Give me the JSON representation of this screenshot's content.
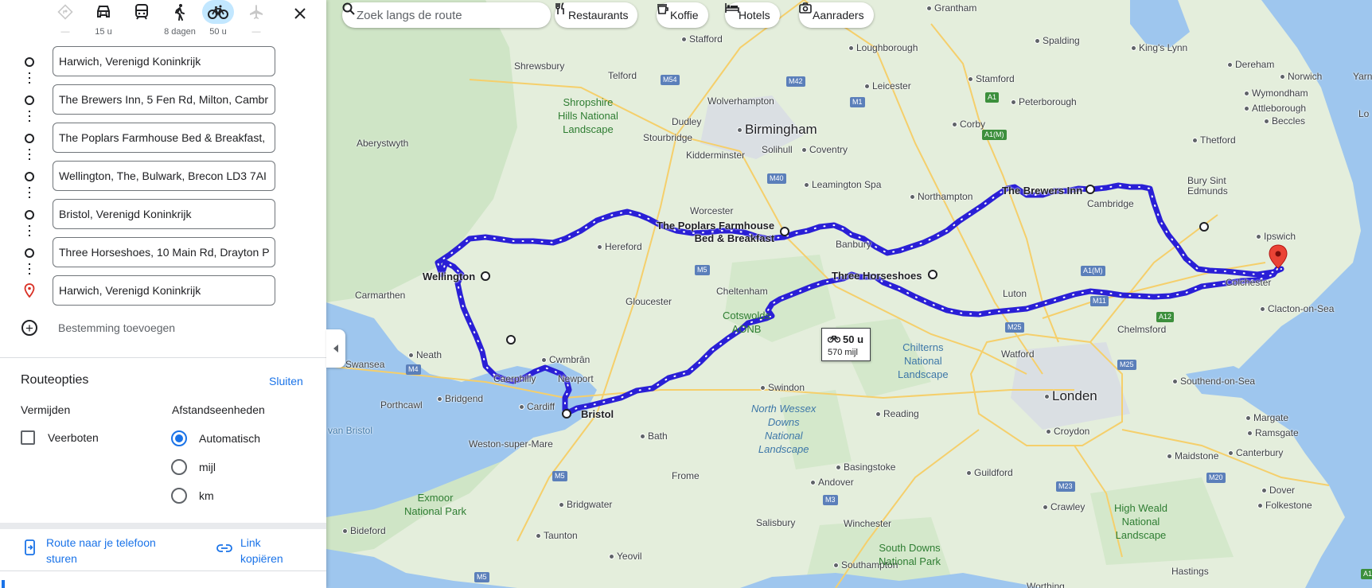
{
  "modes": [
    {
      "name": "best-route",
      "label": "—",
      "icon": "diamond-route-icon",
      "active": false,
      "disabled": true
    },
    {
      "name": "car",
      "label": "15 u",
      "icon": "car-icon",
      "active": false,
      "disabled": false
    },
    {
      "name": "transit",
      "label": "",
      "icon": "train-icon",
      "active": false,
      "disabled": false
    },
    {
      "name": "walk",
      "label": "8 dagen",
      "icon": "walk-icon",
      "active": false,
      "disabled": false
    },
    {
      "name": "bike",
      "label": "50 u",
      "icon": "bike-icon",
      "active": true,
      "disabled": false
    },
    {
      "name": "flight",
      "label": "—",
      "icon": "airplane-icon",
      "active": false,
      "disabled": true
    }
  ],
  "stops": [
    "Harwich, Verenigd Koninkrijk",
    "The Brewers Inn, 5 Fen Rd, Milton, Cambr",
    "The Poplars Farmhouse Bed & Breakfast,",
    "Wellington, The, Bulwark, Brecon LD3 7AI",
    "Bristol, Verenigd Koninkrijk",
    "Three Horseshoes, 10 Main Rd, Drayton P",
    "Harwich, Verenigd Koninkrijk"
  ],
  "add_destination": "Bestemming toevoegen",
  "options": {
    "title": "Routeopties",
    "close": "Sluiten",
    "avoid_heading": "Vermijden",
    "avoid_item": "Veerboten",
    "units_heading": "Afstandseenheden",
    "units": [
      "Automatisch",
      "mijl",
      "km"
    ],
    "units_selected": "Automatisch"
  },
  "share": {
    "send_phone": "Route naar je telefoon sturen",
    "copy_link": "Link kopiëren"
  },
  "map": {
    "search_placeholder": "Zoek langs de route",
    "chips": [
      "Restaurants",
      "Koffie",
      "Hotels",
      "Aanraders"
    ],
    "route_time": "50 u",
    "route_distance": "570 mijl",
    "route_color": "#4a2ee8",
    "water_color": "#9ec6ee",
    "land_color": "#e3eedb",
    "markers": {
      "stops": [
        "The Brewers Inn",
        "The Poplars Farmhouse Bed & Breakfast",
        "Wellington",
        "Three Horseshoes",
        "Bristol"
      ]
    },
    "places": {
      "grantham": "Grantham",
      "stafford": "Stafford",
      "spalding": "Spalding",
      "kings_lynn": "King's Lynn",
      "norwich": "Norwich",
      "yarn": "Yarn",
      "loughborough": "Loughborough",
      "shrewsbury": "Shrewsbury",
      "dereham": "Dereham",
      "telford": "Telford",
      "stamford": "Stamford",
      "wymondham": "Wymondham",
      "leicester": "Leicester",
      "wolverhampton": "Wolverhampton",
      "attleborough": "Attleborough",
      "lo": "Lo",
      "peterborough": "Peterborough",
      "beccles": "Beccles",
      "birmingham": "Birmingham",
      "dudley": "Dudley",
      "aberystwyth": "Aberystwyth",
      "stourbridge": "Stourbridge",
      "solihull": "Solihull",
      "corby": "Corby",
      "coventry": "Coventry",
      "thetford": "Thetford",
      "kidderminster": "Kidderminster",
      "leamington": "Leamington Spa",
      "bury": "Bury Sint\nEdmunds",
      "northampton": "Northampton",
      "brewers_inn": "The Brewers Inn",
      "cambridge": "Cambridge",
      "worcester": "Worcester",
      "poplars": "The Poplars Farmhouse\nBed & Breakfast",
      "ipswich": "Ipswich",
      "hereford": "Hereford",
      "banbury": "Banbury",
      "wellington": "Wellington",
      "colchester": "Colchester",
      "cheltenham": "Cheltenham",
      "three_horseshoes": "Three Horseshoes",
      "carmarthen": "Carmarthen",
      "luton": "Luton",
      "clacton": "Clacton-on-Sea",
      "gloucester": "Gloucester",
      "chelmsford": "Chelmsford",
      "watford": "Watford",
      "swansea": "Swansea",
      "neath": "Neath",
      "cwmbran": "Cwmbrân",
      "caerphilly": "Caerphilly",
      "newport": "Newport",
      "swindon": "Swindon",
      "southend": "Southend-on-Sea",
      "london": "Londen",
      "bridgend": "Bridgend",
      "cardiff": "Cardiff",
      "porthcawl": "Porthcawl",
      "margate": "Margate",
      "bristol": "Bristol",
      "reading": "Reading",
      "ramsgate": "Ramsgate",
      "bath": "Bath",
      "croydon": "Croydon",
      "weston": "Weston-super-Mare",
      "canterbury": "Canterbury",
      "basingstoke": "Basingstoke",
      "guildford": "Guildford",
      "maidstone": "Maidstone",
      "andover": "Andover",
      "frome": "Frome",
      "dover": "Dover",
      "crawley": "Crawley",
      "folkestone": "Folkestone",
      "bridgwater": "Bridgwater",
      "bideford": "Bideford",
      "taunton": "Taunton",
      "salisbury": "Salisbury",
      "winchester": "Winchester",
      "yeovil": "Yeovil",
      "southampton": "Southampton",
      "hastings": "Hastings",
      "worthing": "Worthing",
      "van_bristol": "van Bristol"
    },
    "parks": {
      "shropshire": "Shropshire\nHills National\nLandscape",
      "cotswolds": "Cotswolds\nAONB",
      "chilterns": "Chilterns\nNational\nLandscape",
      "north_wessex": "North Wessex\nDowns\nNational\nLandscape",
      "exmoor": "Exmoor\nNational Park",
      "south_downs": "South Downs\nNational Park",
      "high_weald": "High Weald\nNational\nLandscape"
    },
    "roads": [
      "M54",
      "M42",
      "M1",
      "A1",
      "A1(M)",
      "M40",
      "M5",
      "A1(M)",
      "M11",
      "A12",
      "M4",
      "M25",
      "M25",
      "M23",
      "M20",
      "M5",
      "M3",
      "M5",
      "A1"
    ]
  }
}
